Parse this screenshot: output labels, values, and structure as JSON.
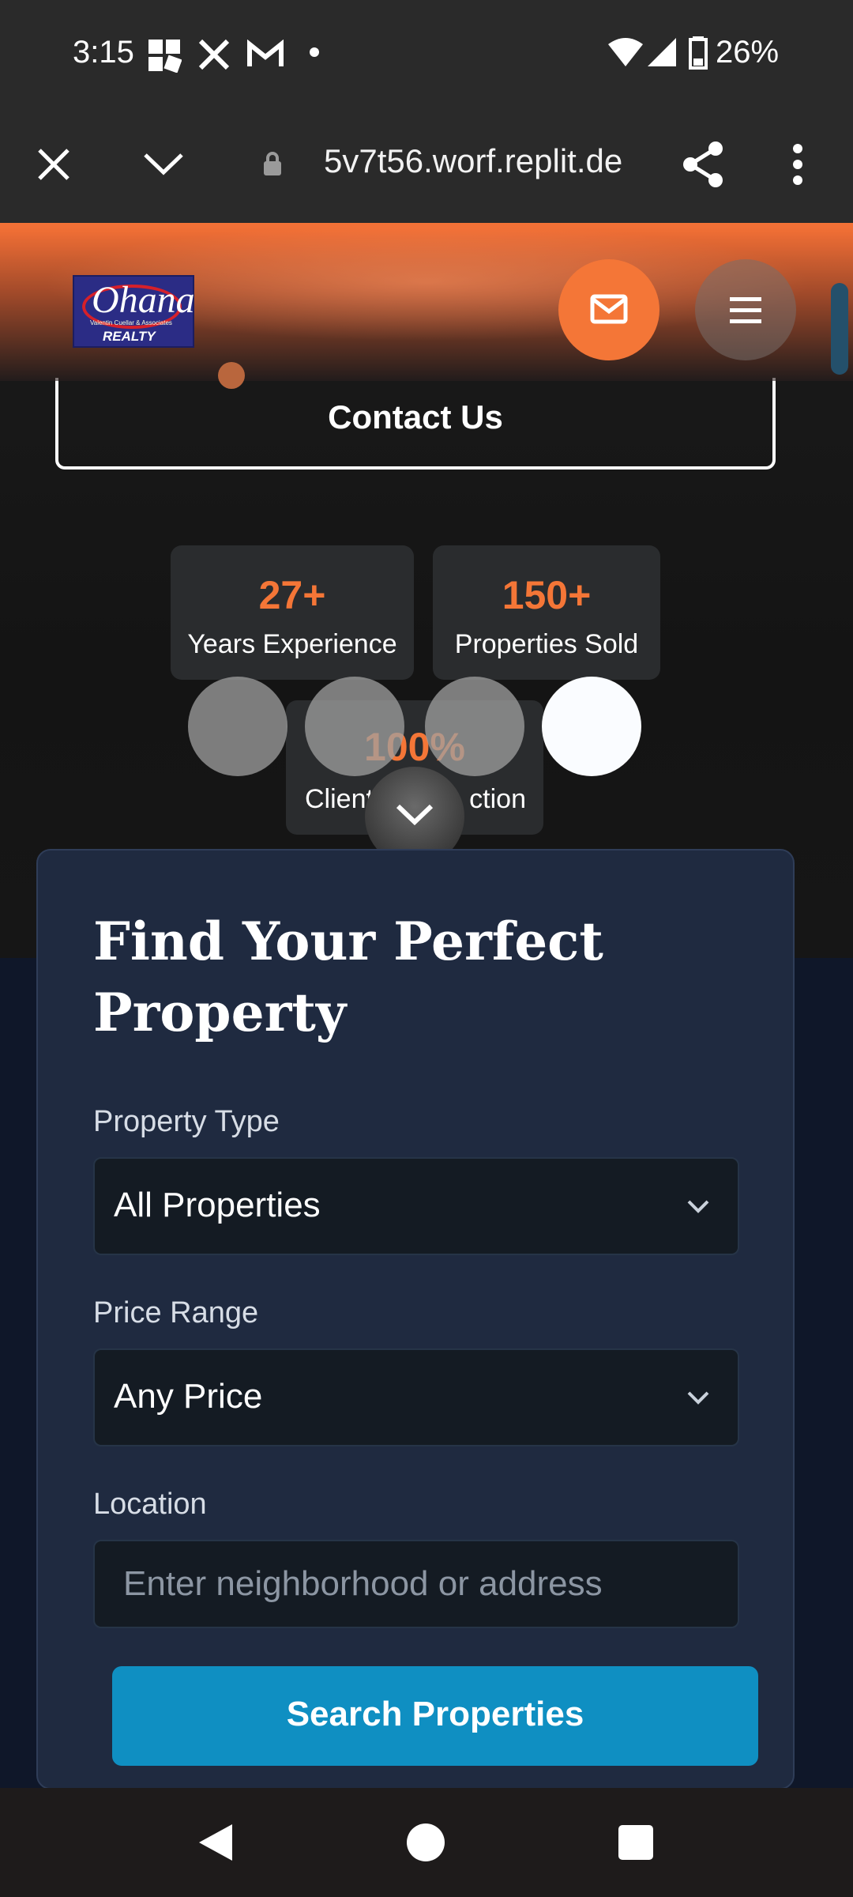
{
  "status_bar": {
    "time": "3:15",
    "battery": "26%",
    "icons": [
      "grid-app-icon",
      "x-icon",
      "gmail-icon",
      "notification-dot-icon",
      "wifi-icon",
      "signal-icon",
      "battery-icon"
    ]
  },
  "browser": {
    "url": "5v7t56.worf.replit.de",
    "icons": [
      "close-icon",
      "chevron-down-icon",
      "lock-icon",
      "share-icon",
      "overflow-menu-icon"
    ]
  },
  "header": {
    "logo": {
      "word": "Ohana",
      "sub": "Valentin Cuellar & Associates",
      "realty": "REALTY"
    },
    "accent": "#f47637"
  },
  "hero": {
    "contact_label": "Contact Us",
    "stats": [
      {
        "value": "27+",
        "label": "Years Experience"
      },
      {
        "value": "150+",
        "label": "Properties Sold"
      },
      {
        "value": "100%",
        "label": "Client Satisfaction"
      }
    ],
    "visible_third_label_left": "Client",
    "visible_third_label_right": "ction"
  },
  "search": {
    "title": "Find Your Perfect Property",
    "property_type_label": "Property Type",
    "property_type_value": "All Properties",
    "price_label": "Price Range",
    "price_value": "Any Price",
    "location_label": "Location",
    "location_placeholder": "Enter neighborhood or address",
    "button_label": "Search Properties",
    "button_color": "#0f8fc2"
  }
}
